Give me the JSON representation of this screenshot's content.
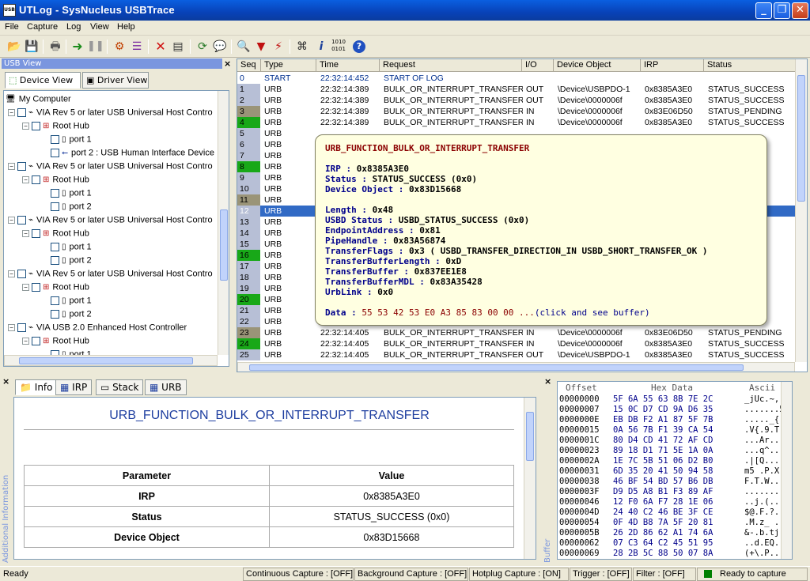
{
  "window": {
    "title": "UTLog - SysNucleus USBTrace"
  },
  "menu": [
    "File",
    "Capture",
    "Log",
    "View",
    "Help"
  ],
  "usb_view": {
    "header": "USB View",
    "tabs": [
      "Device View",
      "Driver View"
    ],
    "tree": [
      {
        "label": "My Computer"
      },
      {
        "label": "VIA Rev 5 or later USB Universal Host Contro"
      },
      {
        "label": "Root Hub"
      },
      {
        "label": "port 1"
      },
      {
        "label": "port 2 : USB Human Interface Device"
      },
      {
        "label": "VIA Rev 5 or later USB Universal Host Contro"
      },
      {
        "label": "Root Hub"
      },
      {
        "label": "port 1"
      },
      {
        "label": "port 2"
      },
      {
        "label": "VIA Rev 5 or later USB Universal Host Contro"
      },
      {
        "label": "Root Hub"
      },
      {
        "label": "port 1"
      },
      {
        "label": "port 2"
      },
      {
        "label": "VIA Rev 5 or later USB Universal Host Contro"
      },
      {
        "label": "Root Hub"
      },
      {
        "label": "port 1"
      },
      {
        "label": "port 2"
      },
      {
        "label": "VIA USB 2.0 Enhanced Host Controller"
      },
      {
        "label": "Root Hub"
      },
      {
        "label": "port 1"
      }
    ]
  },
  "grid": {
    "columns": [
      "Seq",
      "Type",
      "Time",
      "Request",
      "I/O",
      "Device Object",
      "IRP",
      "Status"
    ],
    "rows": [
      {
        "seq": "0",
        "type": "START",
        "time": "22:32:14:452",
        "req": "START OF LOG",
        "io": "",
        "dev": "",
        "irp": "",
        "st": ""
      },
      {
        "seq": "1",
        "type": "URB",
        "time": "22:32:14:389",
        "req": "BULK_OR_INTERRUPT_TRANSFER",
        "io": "OUT",
        "dev": "\\Device\\USBPDO-1",
        "irp": "0x8385A3E0",
        "st": "STATUS_SUCCESS"
      },
      {
        "seq": "2",
        "type": "URB",
        "time": "22:32:14:389",
        "req": "BULK_OR_INTERRUPT_TRANSFER",
        "io": "OUT",
        "dev": "\\Device\\0000006f",
        "irp": "0x8385A3E0",
        "st": "STATUS_SUCCESS"
      },
      {
        "seq": "3",
        "type": "URB",
        "time": "22:32:14:389",
        "req": "BULK_OR_INTERRUPT_TRANSFER",
        "io": "IN",
        "dev": "\\Device\\0000006f",
        "irp": "0x83E06D50",
        "st": "STATUS_PENDING"
      },
      {
        "seq": "4",
        "type": "URB",
        "time": "22:32:14:389",
        "req": "BULK_OR_INTERRUPT_TRANSFER",
        "io": "IN",
        "dev": "\\Device\\0000006f",
        "irp": "0x8385A3E0",
        "st": "STATUS_SUCCESS"
      },
      {
        "seq": "5",
        "type": "URB",
        "time": "",
        "req": "",
        "io": "",
        "dev": "",
        "irp": "",
        "st": ""
      },
      {
        "seq": "6",
        "type": "URB",
        "time": "",
        "req": "",
        "io": "",
        "dev": "",
        "irp": "",
        "st": "NOT_SUPPOR"
      },
      {
        "seq": "7",
        "type": "URB",
        "time": "",
        "req": "",
        "io": "",
        "dev": "",
        "irp": "",
        "st": ""
      },
      {
        "seq": "8",
        "type": "URB",
        "time": "",
        "req": "",
        "io": "",
        "dev": "",
        "irp": "",
        "st": ""
      },
      {
        "seq": "9",
        "type": "URB",
        "time": "",
        "req": "",
        "io": "",
        "dev": "",
        "irp": "",
        "st": ""
      },
      {
        "seq": "10",
        "type": "URB",
        "time": "",
        "req": "",
        "io": "",
        "dev": "",
        "irp": "",
        "st": ""
      },
      {
        "seq": "11",
        "type": "URB",
        "time": "",
        "req": "",
        "io": "",
        "dev": "",
        "irp": "",
        "st": ""
      },
      {
        "seq": "12",
        "type": "URB",
        "time": "",
        "req": "",
        "io": "",
        "dev": "",
        "irp": "",
        "st": "SS"
      },
      {
        "seq": "13",
        "type": "URB",
        "time": "",
        "req": "",
        "io": "",
        "dev": "",
        "irp": "",
        "st": ""
      },
      {
        "seq": "14",
        "type": "URB",
        "time": "",
        "req": "",
        "io": "",
        "dev": "",
        "irp": "",
        "st": ""
      },
      {
        "seq": "15",
        "type": "URB",
        "time": "",
        "req": "",
        "io": "",
        "dev": "",
        "irp": "",
        "st": ""
      },
      {
        "seq": "16",
        "type": "URB",
        "time": "",
        "req": "",
        "io": "",
        "dev": "",
        "irp": "",
        "st": ""
      },
      {
        "seq": "17",
        "type": "URB",
        "time": "",
        "req": "",
        "io": "",
        "dev": "",
        "irp": "",
        "st": "NOT_SUPPOR"
      },
      {
        "seq": "18",
        "type": "URB",
        "time": "",
        "req": "",
        "io": "",
        "dev": "",
        "irp": "",
        "st": "NOT_SUPPOR"
      },
      {
        "seq": "19",
        "type": "URB",
        "time": "",
        "req": "",
        "io": "",
        "dev": "",
        "irp": "",
        "st": ""
      },
      {
        "seq": "20",
        "type": "URB",
        "time": "",
        "req": "",
        "io": "",
        "dev": "",
        "irp": "",
        "st": ""
      },
      {
        "seq": "21",
        "type": "URB",
        "time": "",
        "req": "",
        "io": "",
        "dev": "",
        "irp": "",
        "st": ""
      },
      {
        "seq": "22",
        "type": "URB",
        "time": "",
        "req": "",
        "io": "",
        "dev": "",
        "irp": "",
        "st": ""
      },
      {
        "seq": "23",
        "type": "URB",
        "time": "22:32:14:405",
        "req": "BULK_OR_INTERRUPT_TRANSFER",
        "io": "IN",
        "dev": "\\Device\\0000006f",
        "irp": "0x83E06D50",
        "st": "STATUS_PENDING"
      },
      {
        "seq": "24",
        "type": "URB",
        "time": "22:32:14:405",
        "req": "BULK_OR_INTERRUPT_TRANSFER",
        "io": "IN",
        "dev": "\\Device\\0000006f",
        "irp": "0x8385A3E0",
        "st": "STATUS_SUCCESS"
      },
      {
        "seq": "25",
        "type": "URB",
        "time": "22:32:14:405",
        "req": "BULK_OR_INTERRUPT_TRANSFER",
        "io": "OUT",
        "dev": "\\Device\\USBPDO-1",
        "irp": "0x8385A3E0",
        "st": "STATUS_SUCCESS"
      }
    ],
    "seq_colors": {
      "default": "#b7bfd6",
      "in_success": "#18a818",
      "pending": "#9a9478"
    }
  },
  "tooltip": {
    "title": "URB_FUNCTION_BULK_OR_INTERRUPT_TRANSFER",
    "irp_label": "IRP :",
    "irp": "0x8385A3E0",
    "status_label": "Status :",
    "status": "STATUS_SUCCESS (0x0)",
    "devobj_label": "Device Object :",
    "devobj": "0x83D15668",
    "length_label": "Length :",
    "length": "0x48",
    "usbd_label": "USBD Status :",
    "usbd": "USBD_STATUS_SUCCESS (0x0)",
    "ep_label": "EndpointAddress :",
    "ep": "0x81",
    "pipe_label": "PipeHandle :",
    "pipe": "0x83A56874",
    "flags_label": "TransferFlags :",
    "flags": "0x3 ( USBD_TRANSFER_DIRECTION_IN USBD_SHORT_TRANSFER_OK )",
    "buflen_label": "TransferBufferLength :",
    "buflen": "0xD",
    "buf_label": "TransferBuffer :",
    "buf": "0x837EE1E8",
    "mdl_label": "TransferBufferMDL :",
    "mdl": "0x83A35428",
    "link_label": "UrbLink :",
    "link": "0x0",
    "data_label": "Data :",
    "data": "55 53 42 53 E0 A3 85 83 00 00 ...",
    "data_hint": "(click and see buffer)"
  },
  "info": {
    "side_title": "Additional Information",
    "tabs": [
      "Info",
      "IRP",
      "Stack",
      "URB"
    ],
    "title": "URB_FUNCTION_BULK_OR_INTERRUPT_TRANSFER",
    "param_header": "Parameter",
    "value_header": "Value",
    "params": [
      {
        "name": "IRP",
        "value": "0x8385A3E0"
      },
      {
        "name": "Status",
        "value": "STATUS_SUCCESS (0x0)"
      },
      {
        "name": "Device Object",
        "value": "0x83D15668"
      }
    ]
  },
  "hex": {
    "side_title": "Buffer",
    "headers": [
      "Offset",
      "Hex Data",
      "Ascii"
    ],
    "rows": [
      {
        "off": "00000000",
        "hex": "5F 6A 55 63 8B 7E 2C",
        "asc": "_jUc.~,"
      },
      {
        "off": "00000007",
        "hex": "15 0C D7 CD 9A D6 35",
        "asc": ".......5"
      },
      {
        "off": "0000000E",
        "hex": "EB DB F2 A1 87 5F 7B",
        "asc": "....._{"
      },
      {
        "off": "00000015",
        "hex": "0A 56 7B F1 39 CA 54",
        "asc": ".V{.9.T"
      },
      {
        "off": "0000001C",
        "hex": "80 D4 CD 41 72 AF CD",
        "asc": "...Ar.."
      },
      {
        "off": "00000023",
        "hex": "89 18 D1 71 5E 1A 0A",
        "asc": "...q^.."
      },
      {
        "off": "0000002A",
        "hex": "1E 7C 5B 51 06 D2 B0",
        "asc": ".|[Q..."
      },
      {
        "off": "00000031",
        "hex": "6D 35 20 41 50 94 58",
        "asc": "m5 .P.X"
      },
      {
        "off": "00000038",
        "hex": "46 BF 54 BD 57 B6 DB",
        "asc": "F.T.W.."
      },
      {
        "off": "0000003F",
        "hex": "D9 D5 A8 B1 F3 89 AF",
        "asc": "......."
      },
      {
        "off": "00000046",
        "hex": "12 F0 6A F7 28 1E 06",
        "asc": "..j.(.."
      },
      {
        "off": "0000004D",
        "hex": "24 40 C2 46 BE 3F CE",
        "asc": "$@.F.?."
      },
      {
        "off": "00000054",
        "hex": "0F 4D B8 7A 5F 20 81",
        "asc": ".M.z_ ."
      },
      {
        "off": "0000005B",
        "hex": "26 2D 86 62 A1 74 6A",
        "asc": "&-.b.tj"
      },
      {
        "off": "00000062",
        "hex": "07 C3 64 C2 45 51 95",
        "asc": "..d.EQ."
      },
      {
        "off": "00000069",
        "hex": "28 2B 5C 88 50 07 8A",
        "asc": "(+\\.P.."
      }
    ]
  },
  "status": {
    "ready": "Ready",
    "continuous": "Continuous Capture : [OFF]",
    "background": "Background Capture : [OFF]",
    "hotplug": "Hotplug Capture : [ON]",
    "trigger": "Trigger : [OFF]",
    "filter": "Filter : [OFF]",
    "capture": "Ready to capture",
    "capture_color": "#008000"
  }
}
